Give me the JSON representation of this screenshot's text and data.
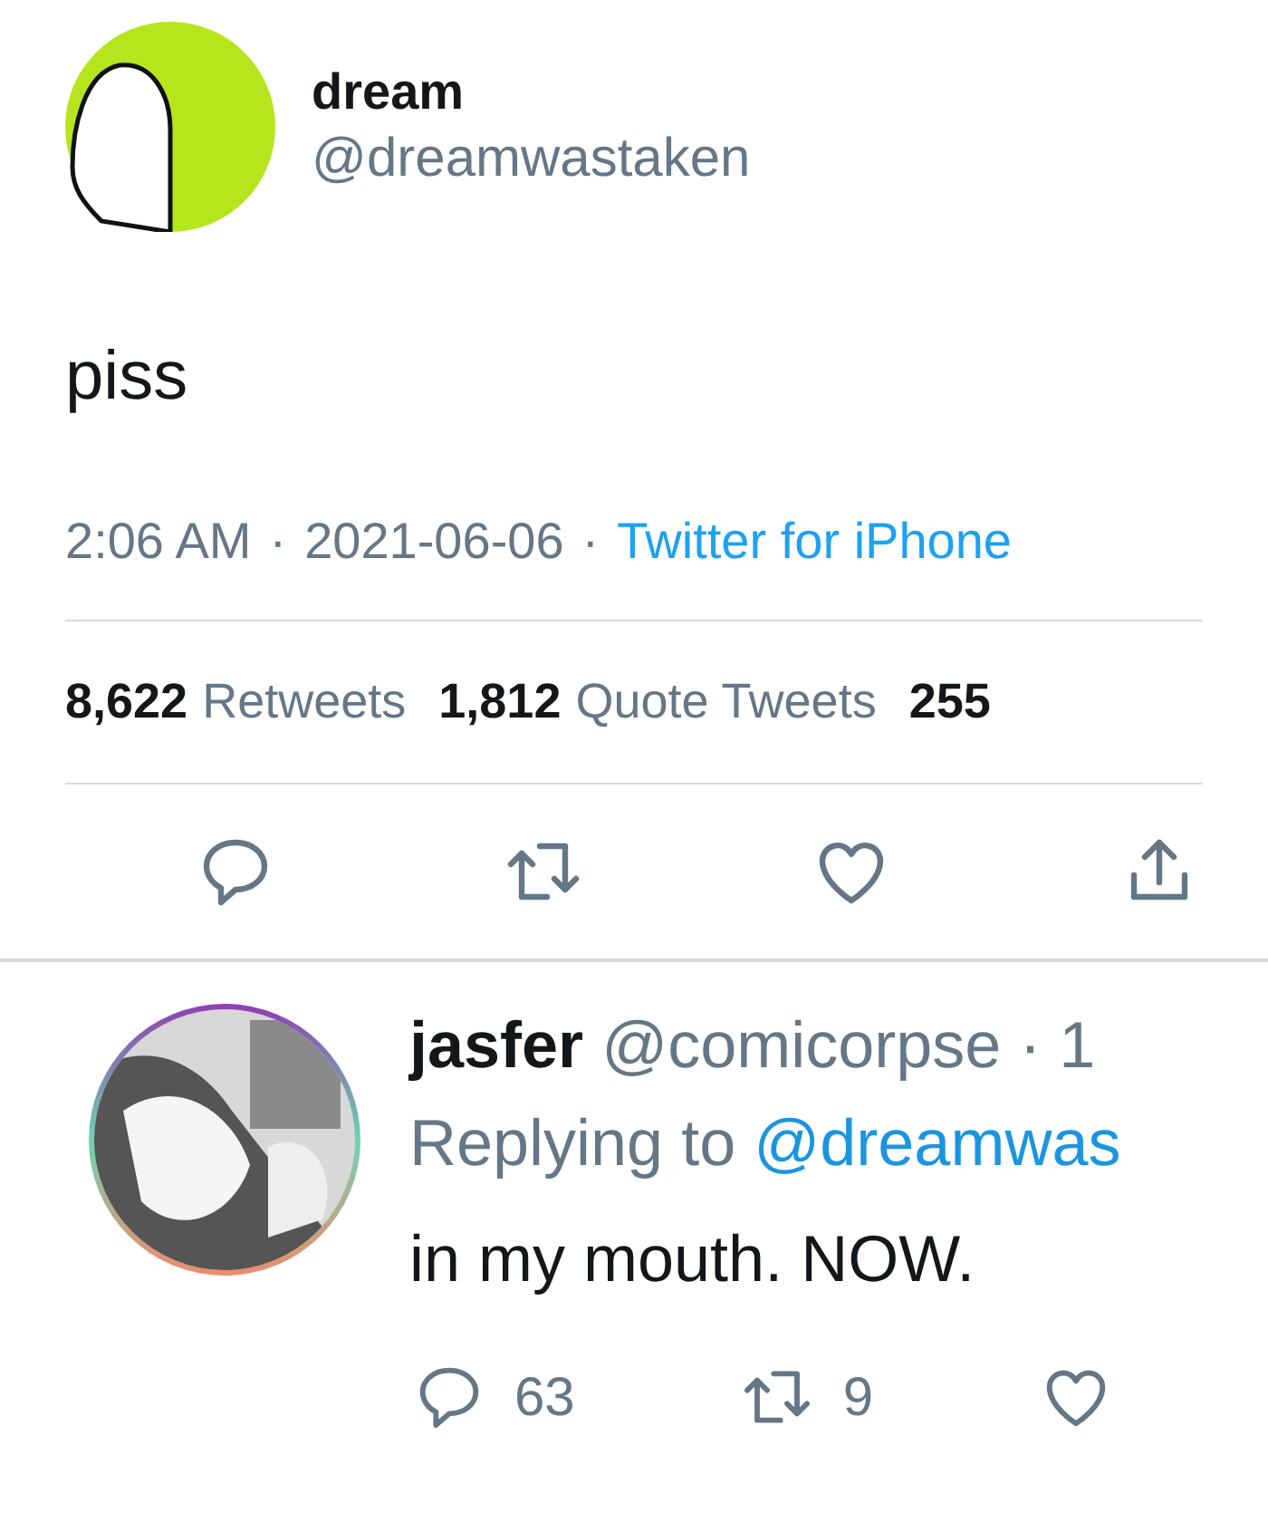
{
  "tweet": {
    "name": "dream",
    "handle": "@dreamwastaken",
    "text": "piss",
    "meta": [
      {
        "kind": "plain",
        "text": "2:06 AM"
      },
      {
        "kind": "sep",
        "text": "·"
      },
      {
        "kind": "plain",
        "text": "2021-06-06"
      },
      {
        "kind": "sep",
        "text": "·"
      },
      {
        "kind": "link",
        "text": "Twitter for iPhone"
      }
    ],
    "stats": [
      {
        "count": "8,622",
        "label": "Retweets"
      },
      {
        "count": "1,812",
        "label": "Quote Tweets"
      },
      {
        "count": "255"
      }
    ],
    "actions": [
      {
        "kind": "reply"
      },
      {
        "kind": "retweet"
      },
      {
        "kind": "like"
      },
      {
        "kind": "share"
      }
    ]
  },
  "reply": {
    "name": "jasfer",
    "handle": "@comicorpse",
    "time": "· 1",
    "replying_prefix": "Replying to",
    "replying_to": "@dreamwas",
    "text": "in my mouth. NOW.",
    "actions": [
      {
        "kind": "reply",
        "count": "63"
      },
      {
        "kind": "retweet",
        "count": "9"
      },
      {
        "kind": "like"
      }
    ]
  }
}
